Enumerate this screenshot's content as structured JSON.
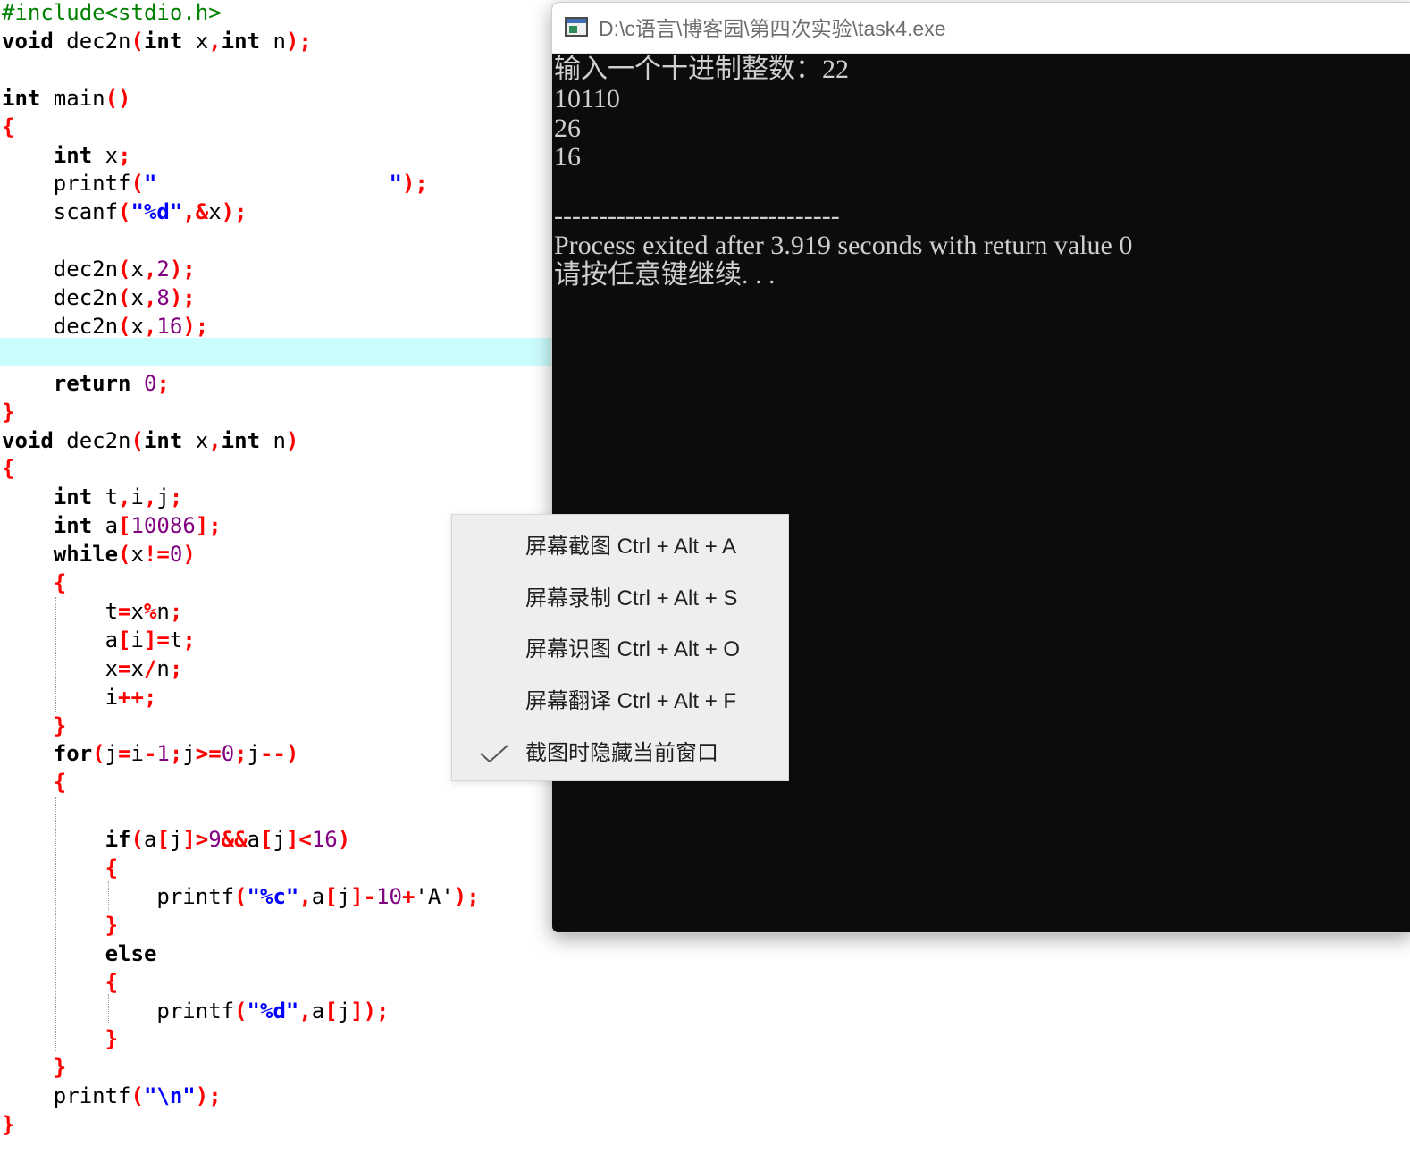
{
  "editor": {
    "lines": [
      [
        [
          "pp",
          "#include<stdio.h>"
        ]
      ],
      [
        [
          "kw",
          "void"
        ],
        [
          "id",
          " dec2n"
        ],
        [
          "sym",
          "("
        ],
        [
          "kw",
          "int"
        ],
        [
          "id",
          " x"
        ],
        [
          "sym",
          ","
        ],
        [
          "kw",
          "int"
        ],
        [
          "id",
          " n"
        ],
        [
          "sym",
          ");"
        ]
      ],
      [],
      [
        [
          "kw",
          "int"
        ],
        [
          "id",
          " main"
        ],
        [
          "sym",
          "()"
        ]
      ],
      [
        [
          "sym",
          "{"
        ]
      ],
      [
        [
          "id",
          "    "
        ],
        [
          "kw",
          "int"
        ],
        [
          "id",
          " x"
        ],
        [
          "sym",
          ";"
        ]
      ],
      [
        [
          "id",
          "    printf"
        ],
        [
          "sym",
          "("
        ],
        [
          "str",
          "\"                  \""
        ],
        [
          "sym",
          ");"
        ]
      ],
      [
        [
          "id",
          "    scanf"
        ],
        [
          "sym",
          "("
        ],
        [
          "str",
          "\"%d\""
        ],
        [
          "sym",
          ","
        ],
        [
          "sym",
          "&"
        ],
        [
          "id",
          "x"
        ],
        [
          "sym",
          ");"
        ]
      ],
      [],
      [
        [
          "id",
          "    dec2n"
        ],
        [
          "sym",
          "("
        ],
        [
          "id",
          "x"
        ],
        [
          "sym",
          ","
        ],
        [
          "num",
          "2"
        ],
        [
          "sym",
          ");"
        ]
      ],
      [
        [
          "id",
          "    dec2n"
        ],
        [
          "sym",
          "("
        ],
        [
          "id",
          "x"
        ],
        [
          "sym",
          ","
        ],
        [
          "num",
          "8"
        ],
        [
          "sym",
          ");"
        ]
      ],
      [
        [
          "id",
          "    dec2n"
        ],
        [
          "sym",
          "("
        ],
        [
          "id",
          "x"
        ],
        [
          "sym",
          ","
        ],
        [
          "num",
          "16"
        ],
        [
          "sym",
          ");"
        ]
      ],
      [],
      [
        [
          "id",
          "    "
        ],
        [
          "kw",
          "return"
        ],
        [
          "id",
          " "
        ],
        [
          "num",
          "0"
        ],
        [
          "sym",
          ";"
        ]
      ],
      [
        [
          "sym",
          "}"
        ]
      ],
      [
        [
          "kw",
          "void"
        ],
        [
          "id",
          " dec2n"
        ],
        [
          "sym",
          "("
        ],
        [
          "kw",
          "int"
        ],
        [
          "id",
          " x"
        ],
        [
          "sym",
          ","
        ],
        [
          "kw",
          "int"
        ],
        [
          "id",
          " n"
        ],
        [
          "sym",
          ")"
        ]
      ],
      [
        [
          "sym",
          "{"
        ]
      ],
      [
        [
          "id",
          "    "
        ],
        [
          "kw",
          "int"
        ],
        [
          "id",
          " t"
        ],
        [
          "sym",
          ","
        ],
        [
          "id",
          "i"
        ],
        [
          "sym",
          ","
        ],
        [
          "id",
          "j"
        ],
        [
          "sym",
          ";"
        ]
      ],
      [
        [
          "id",
          "    "
        ],
        [
          "kw",
          "int"
        ],
        [
          "id",
          " a"
        ],
        [
          "sym",
          "["
        ],
        [
          "num",
          "10086"
        ],
        [
          "sym",
          "];"
        ]
      ],
      [
        [
          "id",
          "    "
        ],
        [
          "kw",
          "while"
        ],
        [
          "sym",
          "("
        ],
        [
          "id",
          "x"
        ],
        [
          "sym",
          "!="
        ],
        [
          "num",
          "0"
        ],
        [
          "sym",
          ")"
        ]
      ],
      [
        [
          "id",
          "    "
        ],
        [
          "sym",
          "{"
        ]
      ],
      [
        [
          "id",
          "        t"
        ],
        [
          "sym",
          "="
        ],
        [
          "id",
          "x"
        ],
        [
          "sym",
          "%"
        ],
        [
          "id",
          "n"
        ],
        [
          "sym",
          ";"
        ]
      ],
      [
        [
          "id",
          "        a"
        ],
        [
          "sym",
          "["
        ],
        [
          "id",
          "i"
        ],
        [
          "sym",
          "]="
        ],
        [
          "id",
          "t"
        ],
        [
          "sym",
          ";"
        ]
      ],
      [
        [
          "id",
          "        x"
        ],
        [
          "sym",
          "="
        ],
        [
          "id",
          "x"
        ],
        [
          "sym",
          "/"
        ],
        [
          "id",
          "n"
        ],
        [
          "sym",
          ";"
        ]
      ],
      [
        [
          "id",
          "        i"
        ],
        [
          "sym",
          "++;"
        ]
      ],
      [
        [
          "id",
          "    "
        ],
        [
          "sym",
          "}"
        ]
      ],
      [
        [
          "id",
          "    "
        ],
        [
          "kw",
          "for"
        ],
        [
          "sym",
          "("
        ],
        [
          "id",
          "j"
        ],
        [
          "sym",
          "="
        ],
        [
          "id",
          "i"
        ],
        [
          "sym",
          "-"
        ],
        [
          "num",
          "1"
        ],
        [
          "sym",
          ";"
        ],
        [
          "id",
          "j"
        ],
        [
          "sym",
          ">="
        ],
        [
          "num",
          "0"
        ],
        [
          "sym",
          ";"
        ],
        [
          "id",
          "j"
        ],
        [
          "sym",
          "--)"
        ]
      ],
      [
        [
          "id",
          "    "
        ],
        [
          "sym",
          "{"
        ]
      ],
      [],
      [
        [
          "id",
          "        "
        ],
        [
          "kw",
          "if"
        ],
        [
          "sym",
          "("
        ],
        [
          "id",
          "a"
        ],
        [
          "sym",
          "["
        ],
        [
          "id",
          "j"
        ],
        [
          "sym",
          "]>"
        ],
        [
          "num",
          "9"
        ],
        [
          "sym",
          "&&"
        ],
        [
          "id",
          "a"
        ],
        [
          "sym",
          "["
        ],
        [
          "id",
          "j"
        ],
        [
          "sym",
          "]<"
        ],
        [
          "num",
          "16"
        ],
        [
          "sym",
          ")"
        ]
      ],
      [
        [
          "id",
          "        "
        ],
        [
          "sym",
          "{"
        ]
      ],
      [
        [
          "id",
          "            printf"
        ],
        [
          "sym",
          "("
        ],
        [
          "str",
          "\"%c\""
        ],
        [
          "sym",
          ","
        ],
        [
          "id",
          "a"
        ],
        [
          "sym",
          "["
        ],
        [
          "id",
          "j"
        ],
        [
          "sym",
          "]-"
        ],
        [
          "num",
          "10"
        ],
        [
          "sym",
          "+"
        ],
        [
          "id",
          "'A'"
        ],
        [
          "sym",
          ");"
        ]
      ],
      [
        [
          "id",
          "        "
        ],
        [
          "sym",
          "}"
        ]
      ],
      [
        [
          "id",
          "        "
        ],
        [
          "kw",
          "else"
        ]
      ],
      [
        [
          "id",
          "        "
        ],
        [
          "sym",
          "{"
        ]
      ],
      [
        [
          "id",
          "            printf"
        ],
        [
          "sym",
          "("
        ],
        [
          "str",
          "\"%d\""
        ],
        [
          "sym",
          ","
        ],
        [
          "id",
          "a"
        ],
        [
          "sym",
          "["
        ],
        [
          "id",
          "j"
        ],
        [
          "sym",
          "]);"
        ]
      ],
      [
        [
          "id",
          "        "
        ],
        [
          "sym",
          "}"
        ]
      ],
      [
        [
          "id",
          "    "
        ],
        [
          "sym",
          "}"
        ]
      ],
      [
        [
          "id",
          "    printf"
        ],
        [
          "sym",
          "("
        ],
        [
          "str",
          "\"\\n\""
        ],
        [
          "sym",
          ");"
        ]
      ],
      [
        [
          "sym",
          "}"
        ]
      ]
    ]
  },
  "console": {
    "title": "D:\\c语言\\博客园\\第四次实验\\task4.exe",
    "output": [
      "输入一个十进制整数：22",
      "10110",
      "26",
      "16",
      "",
      "--------------------------------",
      "Process exited after 3.919 seconds with return value 0",
      "请按任意键继续. . ."
    ]
  },
  "menu": {
    "items": [
      {
        "label": "屏幕截图 Ctrl + Alt + A",
        "checked": false
      },
      {
        "label": "屏幕录制 Ctrl + Alt + S",
        "checked": false
      },
      {
        "label": "屏幕识图 Ctrl + Alt + O",
        "checked": false
      },
      {
        "label": "屏幕翻译 Ctrl + Alt + F",
        "checked": false
      },
      {
        "label": "截图时隐藏当前窗口",
        "checked": true
      }
    ]
  }
}
